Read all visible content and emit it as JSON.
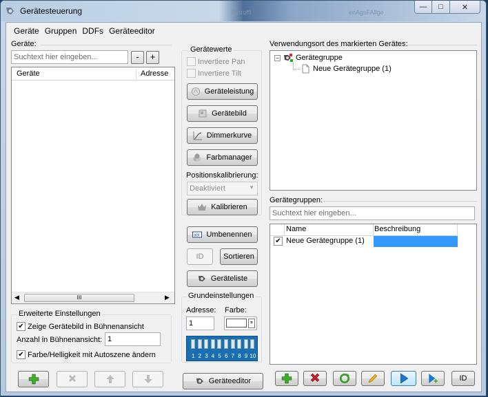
{
  "window": {
    "title": "Gerätesteuerung",
    "bg_text_1": "Betroffl",
    "bg_text_2": "enAgsFAllge",
    "min": "—",
    "max": "□",
    "close": "✕"
  },
  "menu": [
    "Geräte",
    "Gruppen",
    "DDFs",
    "Geräteeditor"
  ],
  "left": {
    "label": "Geräte:",
    "search_placeholder": "Suchtext hier eingeben...",
    "minus": "-",
    "plus": "+",
    "columns": [
      "Geräte",
      "Adresse"
    ],
    "scroll_grip": "III",
    "advanced_title": "Erweiterte Einstellungen",
    "show_image_label": "Zeige Gerätebild in Bühnenansicht",
    "count_label": "Anzahl in Bühnenansicht:",
    "count_value": "1",
    "color_label": "Farbe/Helligkeit mit Autoszene ändern"
  },
  "middle": {
    "values_title": "Gerätewerte",
    "invert_pan": "Invertiere Pan",
    "invert_tilt": "Invertiere Tilt",
    "btn_power": "Geräteleistung",
    "btn_image": "Gerätebild",
    "btn_dimmer": "Dimmerkurve",
    "btn_color": "Farbmanager",
    "pos_label": "Positionskalibrierung:",
    "pos_value": "Deaktiviert",
    "btn_calibrate": "Kalibrieren",
    "btn_rename": "Umbenennen",
    "btn_id": "ID",
    "btn_sort": "Sortieren",
    "btn_list": "Geräteliste",
    "basic_title": "Grundeinstellungen",
    "address_label": "Adresse:",
    "address_value": "1",
    "color_label": "Farbe:",
    "dip_numbers": [
      "1",
      "2",
      "3",
      "4",
      "5",
      "6",
      "7",
      "8",
      "9",
      "10"
    ],
    "btn_editor": "Geräteeditor"
  },
  "right": {
    "usage_label": "Verwendungsort des markierten Gerätes:",
    "tree_root": "Gerätegruppe",
    "tree_child": "Neue Gerätegruppe (1)",
    "expander": "−",
    "groups_label": "Gerätegruppen:",
    "search_placeholder": "Suchtext hier eingeben...",
    "columns": [
      "Name",
      "Beschreibung"
    ],
    "row_name": "Neue Gerätegruppe (1)",
    "row_checked": "✔",
    "btn_id": "ID"
  },
  "colors": {
    "accent_green": "#3fae2a",
    "accent_red": "#c8202a",
    "selection": "#3399ff",
    "dip_blue": "#1a6fb3"
  }
}
